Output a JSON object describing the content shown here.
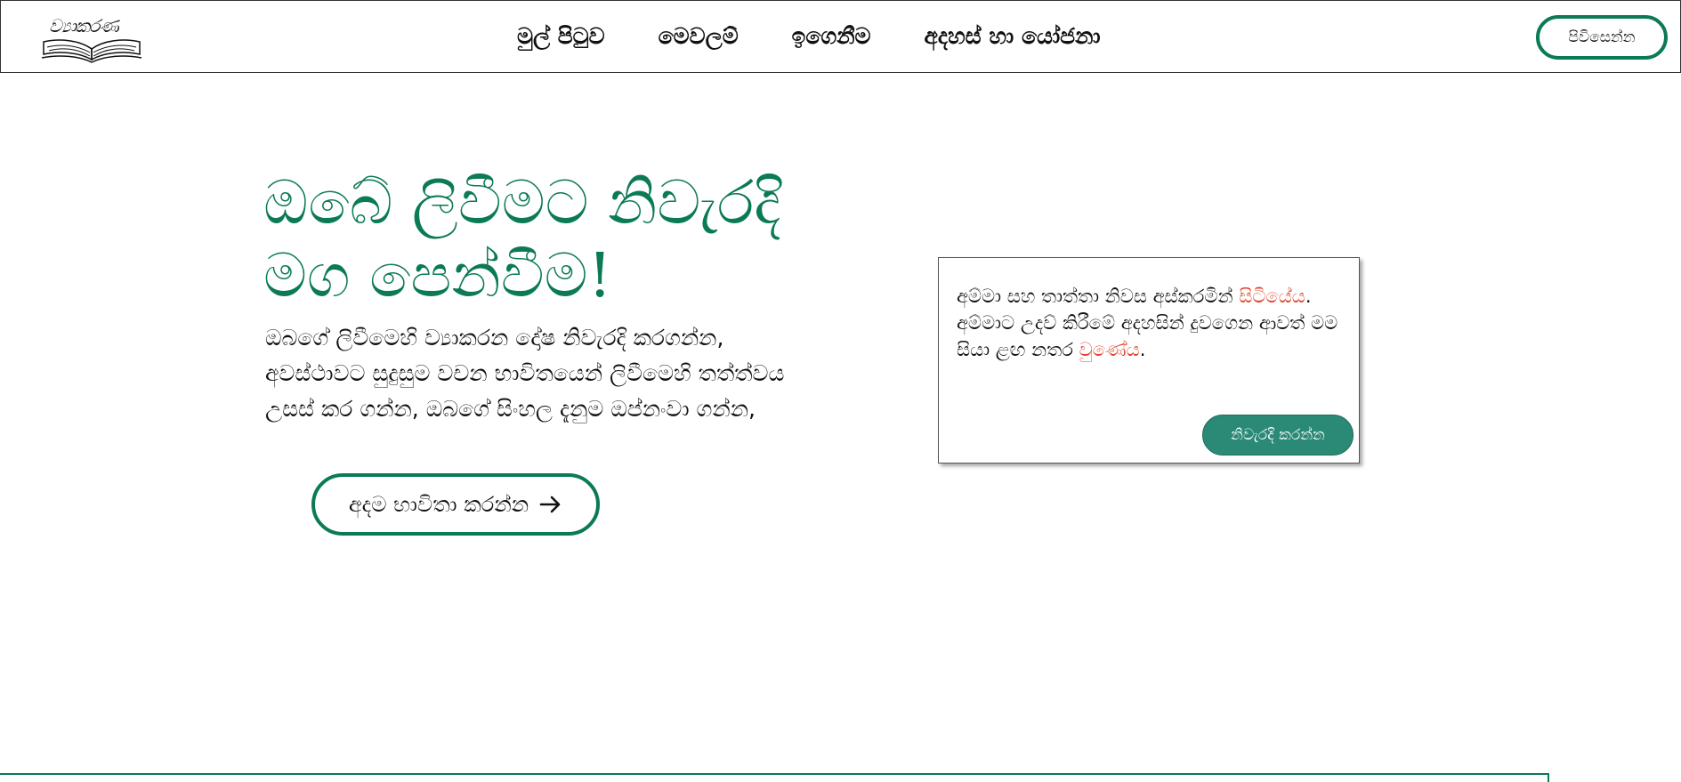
{
  "header": {
    "logo_text": "ව්‍යාකරණ",
    "nav": [
      "මුල් පිටුව",
      "මෙවලම්",
      "ඉගෙනීම",
      "අදහස් හා යෝජනා"
    ],
    "login_label": "පිවිසෙන්න"
  },
  "hero": {
    "title_line1": "ඔබේ ලිවීමට නිවැරදි",
    "title_line2": "මග පෙන්වීම!",
    "desc_line1": "ඔබගේ ලිවීමෙහි ව්‍යාකරන දෝෂ නිවැරදි කරගන්න,",
    "desc_line2": "අවස්ථාවට සුදුසුම වචන භාවිතයෙන් ලිවීමෙහි තත්ත්වය",
    "desc_line3": "උසස් කර ගන්න, ඔබගේ සිංහල දැනුම ඔප්නංවා ගන්න,",
    "cta_label": "අදම භාවිතා කරන්න"
  },
  "demo": {
    "part1": "අම්මා සහ තාත්තා නිවස අස්කරමින් ",
    "error1": "සිටියේය",
    "part2": ". අම්මාට උදව් කිරීමේ අදහසින් දුවගෙන ආවත් මම සියා ළඟ නතර ",
    "error2": "වුණේය",
    "part3": ".",
    "button_label": "නිවැරදි කරන්න"
  },
  "colors": {
    "accent": "#0b7a55",
    "button_fill": "#2b8a76",
    "error": "#e0442c"
  }
}
